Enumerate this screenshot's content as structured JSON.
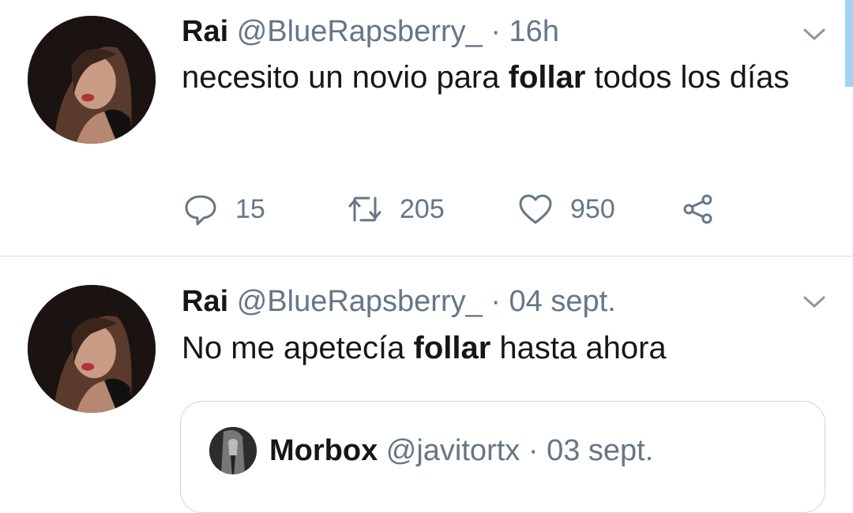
{
  "tweets": [
    {
      "name": "Rai",
      "handle": "@BlueRapsberry_",
      "separator": "·",
      "time": "16h",
      "text_before": "necesito un novio para ",
      "text_bold": "follar",
      "text_after": " todos los días",
      "replies": "15",
      "retweets": "205",
      "likes": "950"
    },
    {
      "name": "Rai",
      "handle": "@BlueRapsberry_",
      "separator": "·",
      "time": "04 sept.",
      "text_before": "No me apetecía ",
      "text_bold": "follar",
      "text_after": " hasta ahora",
      "quote": {
        "name": "Morbox",
        "handle": "@javitortx",
        "separator": "·",
        "time": "03 sept."
      }
    }
  ],
  "colors": {
    "text": "#14171a",
    "muted": "#657786",
    "divider": "#d7dde1",
    "scroll": "#9fd3f5"
  },
  "icons": [
    "reply-icon",
    "retweet-icon",
    "like-icon",
    "share-icon",
    "chevron-down-icon"
  ]
}
